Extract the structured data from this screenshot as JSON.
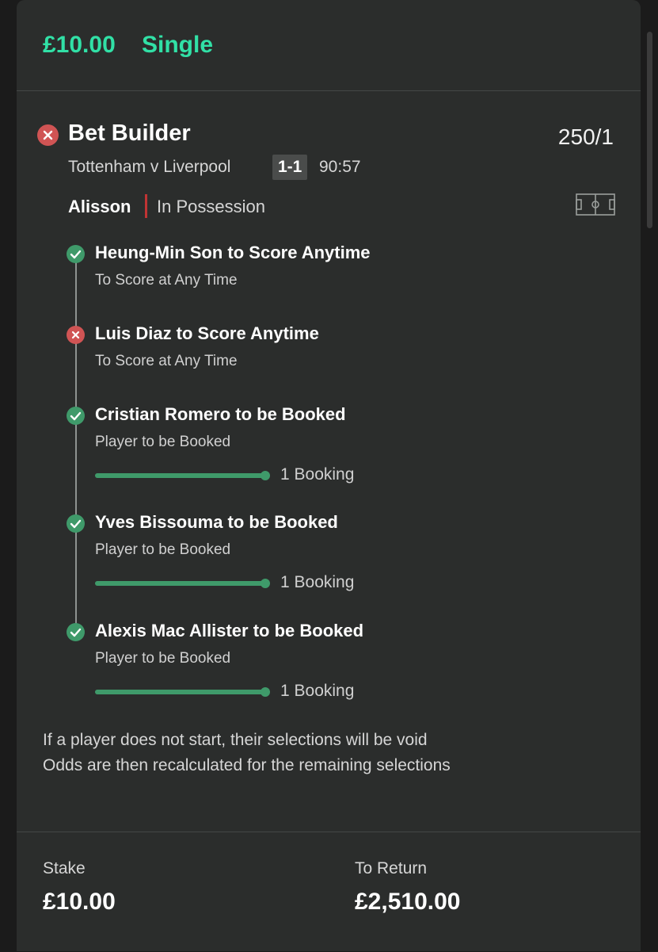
{
  "header": {
    "stake": "£10.00",
    "bet_type": "Single"
  },
  "bet_builder": {
    "title": "Bet Builder",
    "odds": "250/1",
    "status_icon": "cross-icon",
    "match": {
      "name": "Tottenham v Liverpool",
      "score": "1-1",
      "time": "90:57"
    },
    "possession": {
      "team": "Alisson",
      "label": "In Possession",
      "icon": "pitch-icon"
    },
    "legs": [
      {
        "title": "Heung-Min Son to Score Anytime",
        "market": "To Score at Any Time",
        "status": "won"
      },
      {
        "title": "Luis Diaz to Score Anytime",
        "market": "To Score at Any Time",
        "status": "lost"
      },
      {
        "title": "Cristian Romero to be Booked",
        "market": "Player to be Booked",
        "status": "won",
        "progress": {
          "fraction": 1.0,
          "label": "1 Booking"
        }
      },
      {
        "title": "Yves Bissouma to be Booked",
        "market": "Player to be Booked",
        "status": "won",
        "progress": {
          "fraction": 1.0,
          "label": "1 Booking"
        }
      },
      {
        "title": "Alexis Mac Allister to be Booked",
        "market": "Player to be Booked",
        "status": "won",
        "progress": {
          "fraction": 1.0,
          "label": "1 Booking"
        }
      }
    ],
    "notes": [
      "If a player does not start, their selections will be void",
      "Odds are then recalculated for the remaining selections"
    ]
  },
  "footer": {
    "stake_label": "Stake",
    "stake_value": "£10.00",
    "return_label": "To Return",
    "return_value": "£2,510.00"
  },
  "colors": {
    "accent": "#31e0a6",
    "won": "#3f9a6a",
    "lost": "#d05454",
    "card": "#2b2d2c"
  }
}
